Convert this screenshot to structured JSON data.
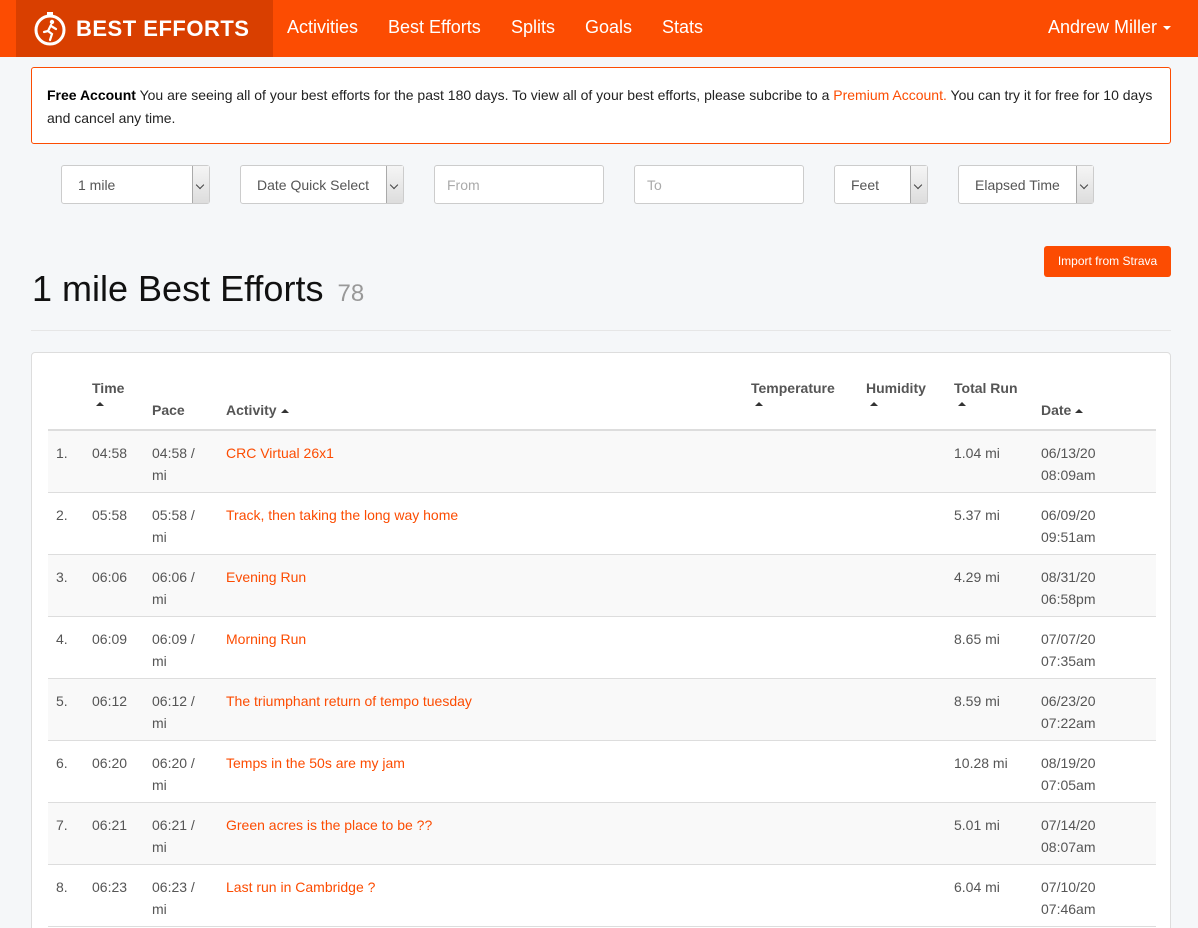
{
  "nav": {
    "brand": "BEST EFFORTS",
    "links": [
      "Activities",
      "Best Efforts",
      "Splits",
      "Goals",
      "Stats"
    ],
    "user": "Andrew Miller"
  },
  "alert": {
    "title": "Free Account",
    "text1": " You are seeing all of your best efforts for the past 180 days. To view all of your best efforts, please subcribe to a ",
    "link": "Premium Account.",
    "text2": " You can try it for free for 10 days and cancel any time."
  },
  "filters": {
    "distance": "1 mile",
    "date_quick": "Date Quick Select",
    "from_placeholder": "From",
    "to_placeholder": "To",
    "units": "Feet",
    "time_type": "Elapsed Time"
  },
  "import_button": "Import from Strava",
  "page": {
    "title": "1 mile Best Efforts",
    "count": "78"
  },
  "table": {
    "headers": {
      "time": "Time",
      "pace": "Pace",
      "activity": "Activity",
      "temperature": "Temperature",
      "humidity": "Humidity",
      "total_run": "Total Run",
      "date": "Date"
    },
    "rows": [
      {
        "rank": "1.",
        "time": "04:58",
        "pace1": "04:58 /",
        "pace2": "mi",
        "activity": "CRC Virtual 26x1",
        "total": "1.04 mi",
        "date": "06/13/20",
        "clock": "08:09am"
      },
      {
        "rank": "2.",
        "time": "05:58",
        "pace1": "05:58 /",
        "pace2": "mi",
        "activity": "Track, then taking the long way home",
        "total": "5.37 mi",
        "date": "06/09/20",
        "clock": "09:51am"
      },
      {
        "rank": "3.",
        "time": "06:06",
        "pace1": "06:06 /",
        "pace2": "mi",
        "activity": "Evening Run",
        "total": "4.29 mi",
        "date": "08/31/20",
        "clock": "06:58pm"
      },
      {
        "rank": "4.",
        "time": "06:09",
        "pace1": "06:09 /",
        "pace2": "mi",
        "activity": "Morning Run",
        "total": "8.65 mi",
        "date": "07/07/20",
        "clock": "07:35am"
      },
      {
        "rank": "5.",
        "time": "06:12",
        "pace1": "06:12 /",
        "pace2": "mi",
        "activity": "The triumphant return of tempo tuesday",
        "total": "8.59 mi",
        "date": "06/23/20",
        "clock": "07:22am"
      },
      {
        "rank": "6.",
        "time": "06:20",
        "pace1": "06:20 /",
        "pace2": "mi",
        "activity": "Temps in the 50s are my jam",
        "total": "10.28 mi",
        "date": "08/19/20",
        "clock": "07:05am"
      },
      {
        "rank": "7.",
        "time": "06:21",
        "pace1": "06:21 /",
        "pace2": "mi",
        "activity": "Green acres is the place to be ??",
        "total": "5.01 mi",
        "date": "07/14/20",
        "clock": "08:07am"
      },
      {
        "rank": "8.",
        "time": "06:23",
        "pace1": "06:23 /",
        "pace2": "mi",
        "activity": "Last run in Cambridge ?",
        "total": "6.04 mi",
        "date": "07/10/20",
        "clock": "07:46am"
      }
    ]
  }
}
